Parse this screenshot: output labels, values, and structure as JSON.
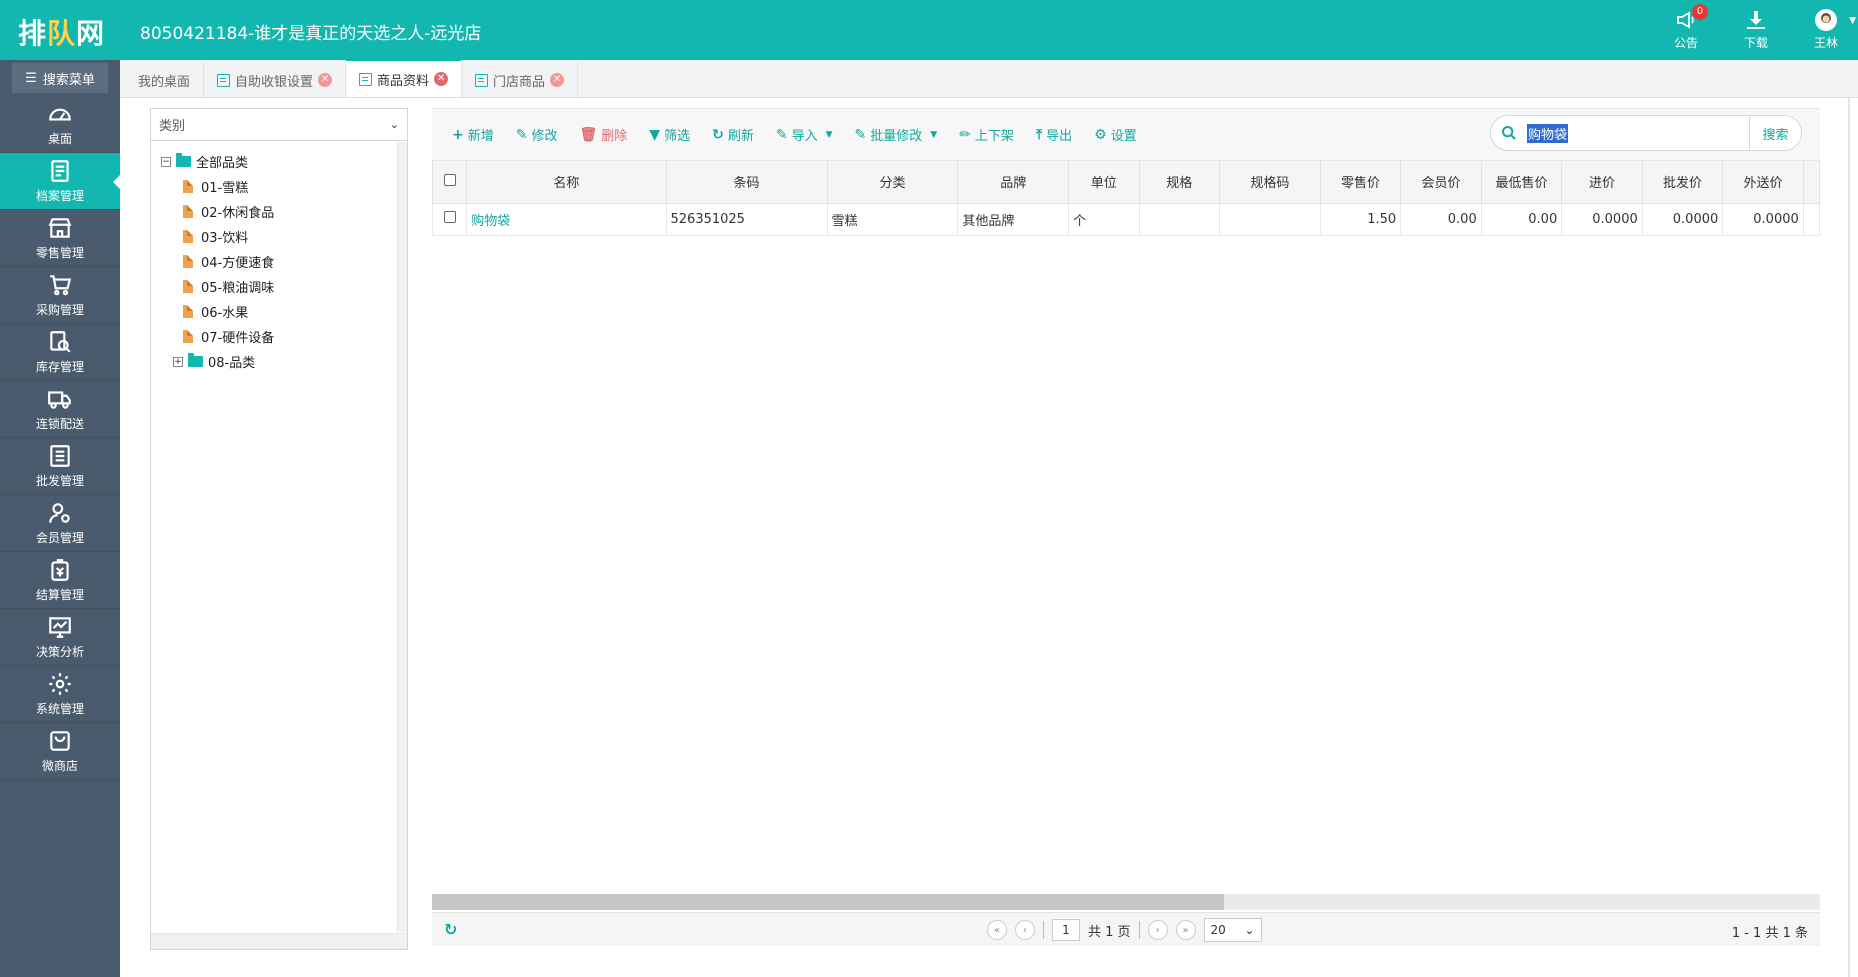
{
  "header": {
    "logo_left": "排",
    "logo_mid": "队",
    "logo_right": "网",
    "title": "8050421184-谁才是真正的天选之人-远光店",
    "notice_label": "公告",
    "notice_count": "0",
    "download_label": "下载",
    "user_name": "王林"
  },
  "sidebar": {
    "search_menu": "搜索菜单",
    "items": [
      {
        "label": "桌面",
        "icon": "dashboard-icon"
      },
      {
        "label": "档案管理",
        "icon": "archive-icon",
        "active": true
      },
      {
        "label": "零售管理",
        "icon": "store-icon"
      },
      {
        "label": "采购管理",
        "icon": "cart-icon"
      },
      {
        "label": "库存管理",
        "icon": "inventory-icon"
      },
      {
        "label": "连锁配送",
        "icon": "truck-icon"
      },
      {
        "label": "批发管理",
        "icon": "wholesale-icon"
      },
      {
        "label": "会员管理",
        "icon": "member-icon"
      },
      {
        "label": "结算管理",
        "icon": "settlement-icon"
      },
      {
        "label": "决策分析",
        "icon": "chart-icon"
      },
      {
        "label": "系统管理",
        "icon": "gear-icon"
      },
      {
        "label": "微商店",
        "icon": "shop-icon"
      }
    ]
  },
  "tabs": [
    {
      "label": "我的桌面"
    },
    {
      "label": "自助收银设置"
    },
    {
      "label": "商品资料"
    },
    {
      "label": "门店商品"
    }
  ],
  "tree": {
    "select_placeholder": "类别",
    "root": "全部品类",
    "children": [
      "01-雪糕",
      "02-休闲食品",
      "03-饮料",
      "04-方便速食",
      "05-粮油调味",
      "06-水果",
      "07-硬件设备",
      "08-品类"
    ]
  },
  "toolbar": {
    "add": "新增",
    "edit": "修改",
    "delete": "删除",
    "filter": "筛选",
    "refresh": "刷新",
    "import": "导入",
    "batch_edit": "批量修改",
    "shelf": "上下架",
    "export": "导出",
    "settings": "设置",
    "search_value": "购物袋",
    "search_button": "搜索"
  },
  "table": {
    "columns": [
      "名称",
      "条码",
      "分类",
      "品牌",
      "单位",
      "规格",
      "规格码",
      "零售价",
      "会员价",
      "最低售价",
      "进价",
      "批发价",
      "外送价"
    ],
    "rows": [
      [
        "购物袋",
        "526351025",
        "雪糕",
        "其他品牌",
        "个",
        "",
        "",
        "1.50",
        "0.00",
        "0.00",
        "0.0000",
        "0.0000",
        "0.0000"
      ]
    ]
  },
  "pager": {
    "page": "1",
    "total_pages": "共 1 页",
    "page_size": "20",
    "summary": "1 - 1    共 1 条"
  },
  "colors": {
    "brand": "#12b8b0",
    "sidebar": "#4b5b6e"
  }
}
